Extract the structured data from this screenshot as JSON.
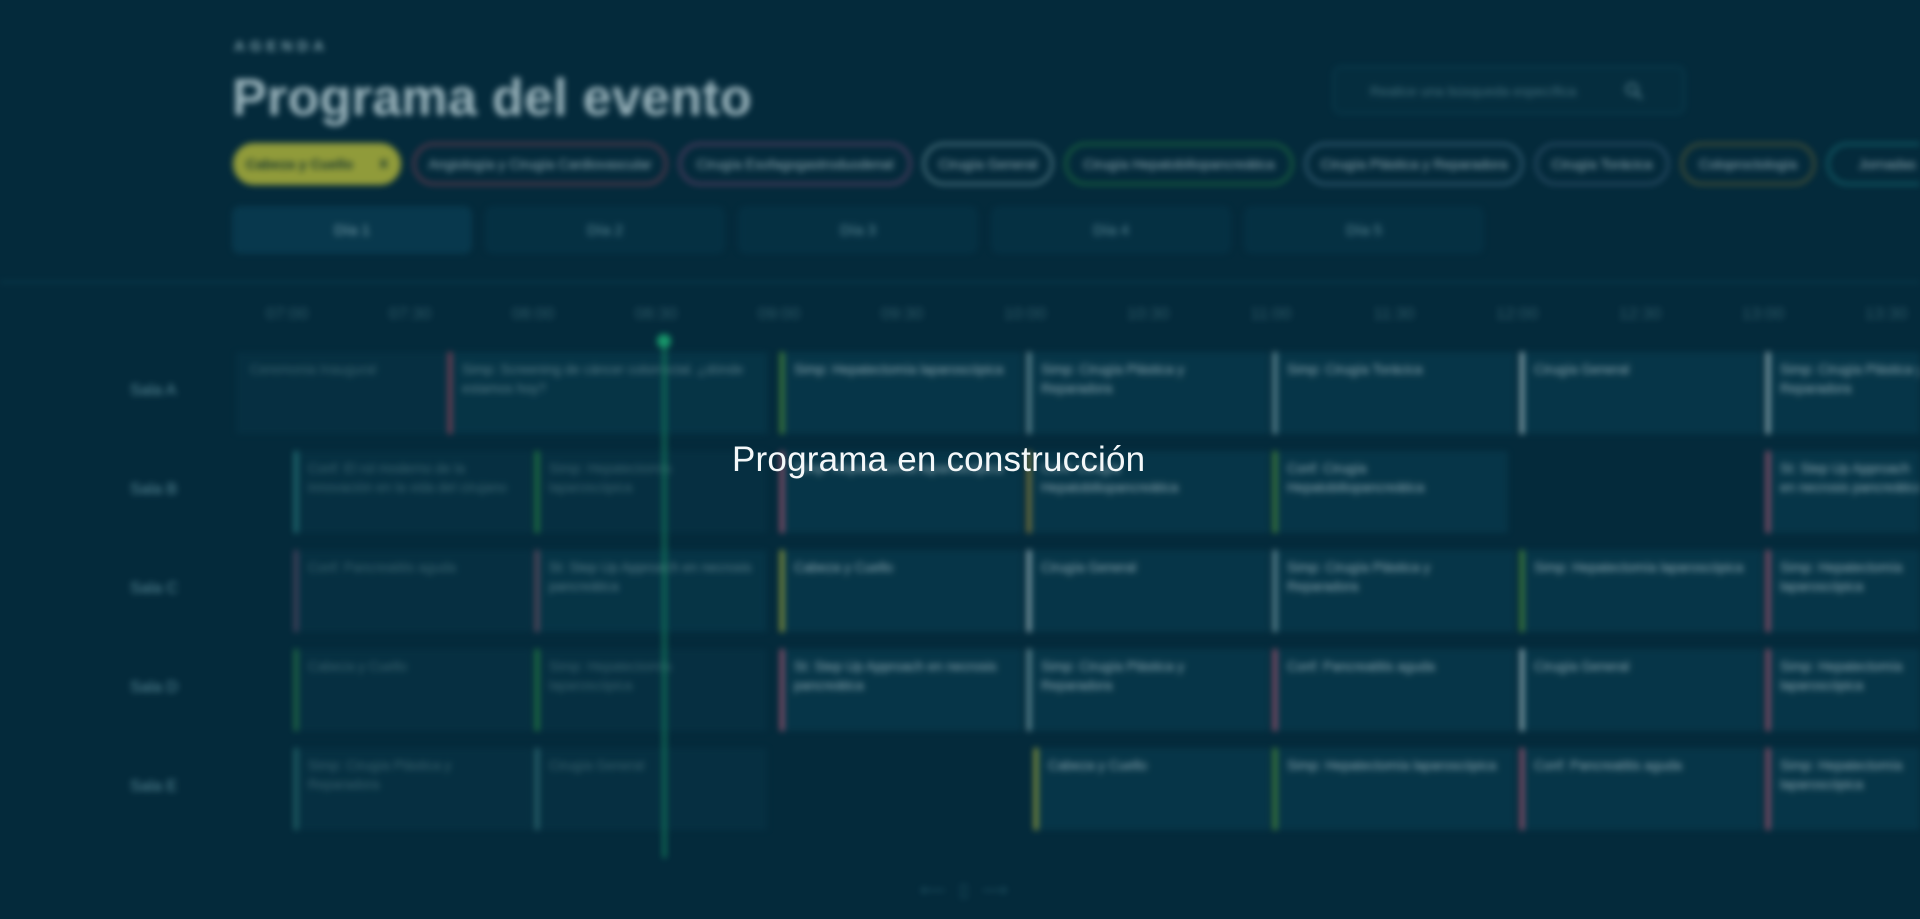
{
  "header": {
    "eyebrow": "AGENDA",
    "title": "Programa del evento",
    "search_placeholder": "Realice una búsqueda específica",
    "search_icon": "search-icon"
  },
  "filters": [
    {
      "label": "Cabeza y Cuello",
      "color": "#c7c73a",
      "active": true,
      "remove": "x"
    },
    {
      "label": "Angiología y Cirugía Cardiovascular",
      "color": "#b2475f"
    },
    {
      "label": "Cirugía Esofagogastroduodenal",
      "color": "#9b4f86"
    },
    {
      "label": "Cirugía General",
      "color": "#8fb8bf"
    },
    {
      "label": "Cirugía Hepatobiliopancreática",
      "color": "#2f9a45"
    },
    {
      "label": "Cirugía Plástica y Reparadora",
      "color": "#5f8aa3"
    },
    {
      "label": "Cirugía Torácica",
      "color": "#4e6f8e"
    },
    {
      "label": "Coloproctología",
      "color": "#8a7a33"
    },
    {
      "label": "Jornadas de",
      "color": "#1f8c8f"
    }
  ],
  "days": [
    {
      "label": "Día 1",
      "active": true
    },
    {
      "label": "Día 2"
    },
    {
      "label": "Día 3"
    },
    {
      "label": "Día 4"
    },
    {
      "label": "Día 5"
    }
  ],
  "times": [
    "07:00",
    "07:30",
    "08:00",
    "08:30",
    "09:00",
    "09:30",
    "10:00",
    "10:30",
    "11:00",
    "11:30",
    "12:00",
    "12:30",
    "13:00",
    "13:30"
  ],
  "rooms": [
    "Sala A",
    "Sala B",
    "Sala C",
    "Sala D",
    "Sala E"
  ],
  "sessions": [
    {
      "room": 0,
      "label": "Ceremonia Inaugural",
      "color": "#073244"
    },
    {
      "room": 0,
      "label": "Simp: Screening de cáncer colorrectal. ¿dónde estamos hoy?",
      "color": "#b2475f"
    },
    {
      "room": 0,
      "label": "Simp: Hepatectomía laparoscópica",
      "color": "#5ea83a"
    },
    {
      "room": 0,
      "label": "Simp: Cirugía Plástica y Reparadora",
      "color": "#8fb8bf"
    },
    {
      "room": 0,
      "label": "Simp: Cirugía Torácica",
      "color": "#8fb8bf"
    },
    {
      "room": 0,
      "label": "Cirugía General",
      "color": "#c8dfe3"
    },
    {
      "room": 0,
      "label": "Simp: Cirugía Plástica y Reparadora",
      "color": "#c8dfe3"
    },
    {
      "room": 1,
      "label": "Conf: El rol moderno de la innovación en la vida del cirujano",
      "color": "#2f8a8a"
    },
    {
      "room": 1,
      "label": "Simp: Hepatectomía laparoscópica",
      "color": "#2f9a45"
    },
    {
      "room": 1,
      "label": "Simp: Hepatectomía laparoscópica",
      "color": "#d0607f"
    },
    {
      "room": 1,
      "label": "Conf: Cirugía Hepatobiliopancreática",
      "color": "#b89a3a"
    },
    {
      "room": 1,
      "label": "Conf: Cirugía Hepatobiliopancreática",
      "color": "#5ea83a"
    },
    {
      "room": 1,
      "label": "St: Step Up Approach en necrosis pancreática",
      "color": "#d0607f"
    },
    {
      "room": 2,
      "label": "Conf: Pancreatitis aguda",
      "color": "#6a4f6e"
    },
    {
      "room": 2,
      "label": "St: Step Up Approach en necrosis pancreática",
      "color": "#8a5a70"
    },
    {
      "room": 2,
      "label": "Cabeza y Cuello",
      "color": "#c7c73a"
    },
    {
      "room": 2,
      "label": "Cirugía General",
      "color": "#c8dfe3"
    },
    {
      "room": 2,
      "label": "Simp: Cirugía Plástica y Reparadora",
      "color": "#8fb8bf"
    },
    {
      "room": 2,
      "label": "Simp: Hepatectomía laparoscópica",
      "color": "#5ea83a"
    },
    {
      "room": 2,
      "label": "Simp: Hepatectomía laparoscópica",
      "color": "#d0607f"
    },
    {
      "room": 3,
      "label": "Cabeza y Cuello",
      "color": "#2f8a4a"
    },
    {
      "room": 3,
      "label": "Simp: Hepatectomía laparoscópica",
      "color": "#2f9a45"
    },
    {
      "room": 3,
      "label": "St: Step Up Approach en necrosis pancreática",
      "color": "#d0607f"
    },
    {
      "room": 3,
      "label": "Simp: Cirugía Plástica y Reparadora",
      "color": "#8fb8bf"
    },
    {
      "room": 3,
      "label": "Conf: Pancreatitis aguda",
      "color": "#d0607f"
    },
    {
      "room": 3,
      "label": "Cirugía General",
      "color": "#c8dfe3"
    },
    {
      "room": 3,
      "label": "Simp: Hepatectomía laparoscópica",
      "color": "#d0607f"
    },
    {
      "room": 4,
      "label": "Simp: Cirugía Plástica y Reparadora",
      "color": "#2f7a7a"
    },
    {
      "room": 4,
      "label": "Cirugía General",
      "color": "#3d7f86"
    },
    {
      "room": 4,
      "label": "Cabeza y Cuello",
      "color": "#c7c73a"
    },
    {
      "room": 4,
      "label": "Simp: Hepatectomía laparoscópica",
      "color": "#5ea83a"
    },
    {
      "room": 4,
      "label": "Conf: Pancreatitis aguda",
      "color": "#d0607f"
    },
    {
      "room": 4,
      "label": "Simp: Hepatectomía laparoscópica",
      "color": "#d0607f"
    }
  ],
  "pager": {
    "prev": "⟵",
    "mid": "▯",
    "next": "⟶"
  },
  "overlay_message": "Programa en construcción"
}
